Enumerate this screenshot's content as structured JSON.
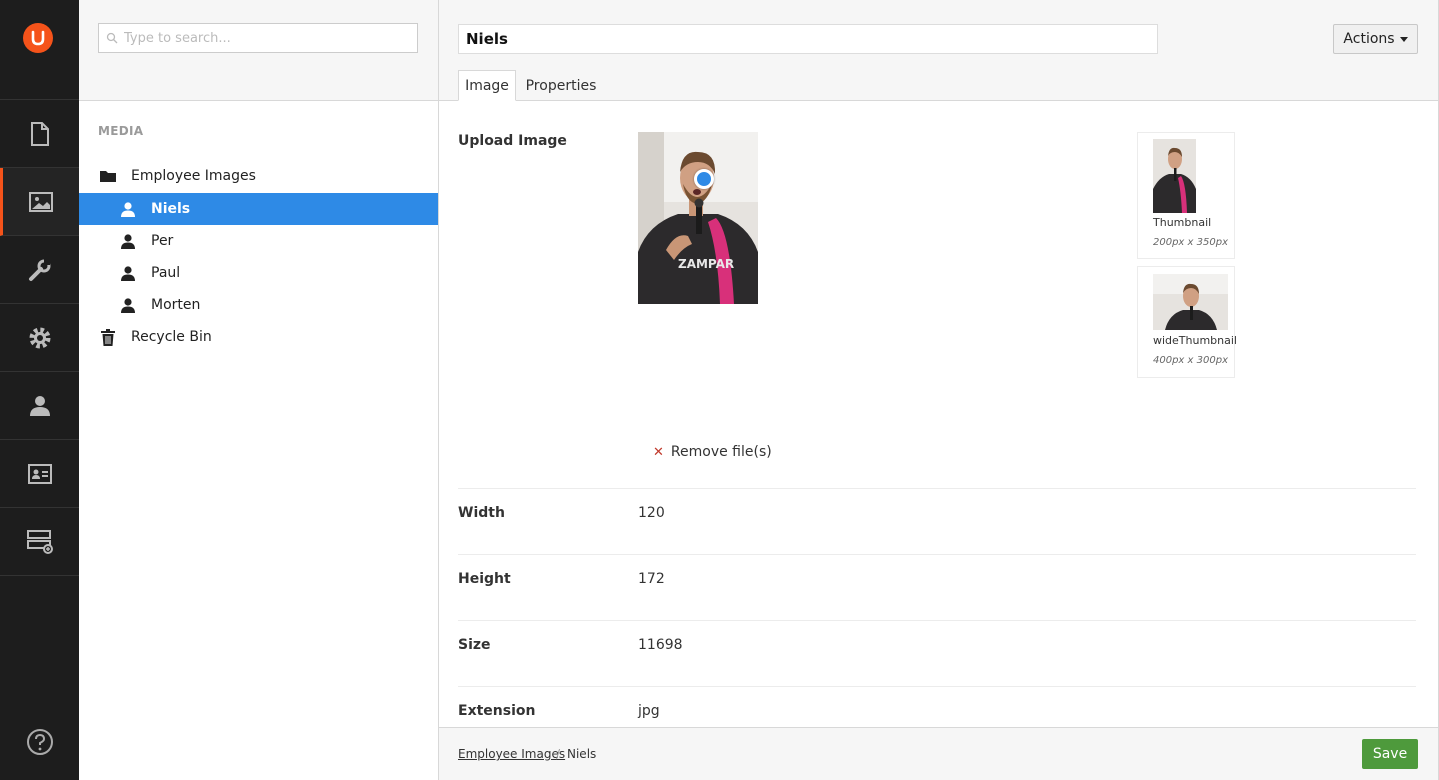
{
  "rail": {
    "items": [
      {
        "icon": "content-icon"
      },
      {
        "icon": "media-icon",
        "active": true
      },
      {
        "icon": "settings-wrench-icon"
      },
      {
        "icon": "developer-gear-icon"
      },
      {
        "icon": "users-icon"
      },
      {
        "icon": "members-icon"
      },
      {
        "icon": "forms-icon"
      }
    ],
    "help_icon": "help-icon"
  },
  "tree": {
    "search_placeholder": "Type to search...",
    "section_title": "MEDIA",
    "items": [
      {
        "label": "Employee Images",
        "icon": "folder-icon"
      },
      {
        "label": "Niels",
        "icon": "user-icon",
        "selected": true
      },
      {
        "label": "Per",
        "icon": "user-icon"
      },
      {
        "label": "Paul",
        "icon": "user-icon"
      },
      {
        "label": "Morten",
        "icon": "user-icon"
      },
      {
        "label": "Recycle Bin",
        "icon": "trash-icon"
      }
    ]
  },
  "editor": {
    "name_value": "Niels",
    "actions_label": "Actions",
    "tabs": [
      {
        "label": "Image",
        "active": true
      },
      {
        "label": "Properties"
      }
    ],
    "upload_label": "Upload Image",
    "crops": [
      {
        "label": "Thumbnail",
        "dims": "200px x 350px"
      },
      {
        "label": "wideThumbnail",
        "dims": "400px x 300px"
      }
    ],
    "remove_label": "Remove file(s)",
    "fields": [
      {
        "label": "Width",
        "value": "120"
      },
      {
        "label": "Height",
        "value": "172"
      },
      {
        "label": "Size",
        "value": "11698"
      },
      {
        "label": "Extension",
        "value": "jpg"
      }
    ]
  },
  "footer": {
    "breadcrumb_parent": "Employee Images",
    "breadcrumb_separator": "/",
    "breadcrumb_current": "Niels",
    "save_label": "Save"
  },
  "colors": {
    "rail_bg": "#1d1d1d",
    "brand": "#f5531a",
    "selection": "#2e8ae6",
    "save": "#4e9a3c"
  }
}
